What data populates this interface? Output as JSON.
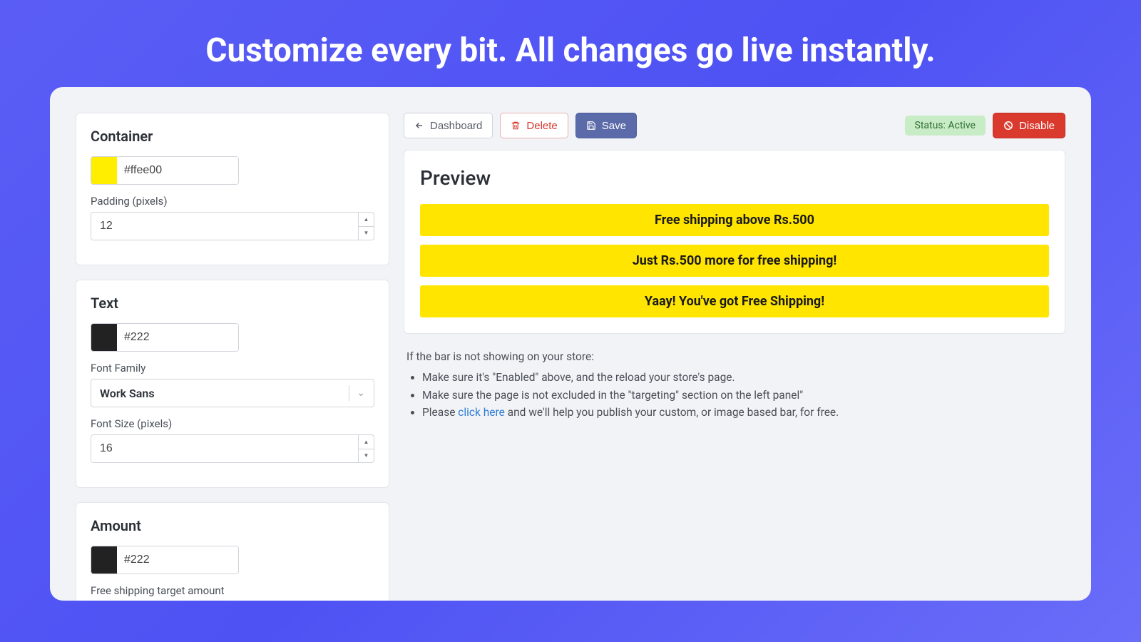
{
  "hero": {
    "title": "Customize every bit. All changes go live instantly."
  },
  "toolbar": {
    "dashboard": "Dashboard",
    "delete": "Delete",
    "save": "Save",
    "status": "Status: Active",
    "disable": "Disable"
  },
  "container": {
    "title": "Container",
    "color": "#ffee00",
    "swatch": "#ffee00",
    "padding_label": "Padding (pixels)",
    "padding": "12"
  },
  "text_section": {
    "title": "Text",
    "color": "#222",
    "swatch": "#222222",
    "font_family_label": "Font Family",
    "font_family": "Work Sans",
    "font_size_label": "Font Size (pixels)",
    "font_size": "16"
  },
  "amount": {
    "title": "Amount",
    "color": "#222",
    "swatch": "#222222",
    "target_label": "Free shipping target amount"
  },
  "preview": {
    "title": "Preview",
    "bars": [
      "Free shipping above Rs.500",
      "Just Rs.500 more for free shipping!",
      "Yaay! You've got Free Shipping!"
    ]
  },
  "help": {
    "intro": "If the bar is not showing on your store:",
    "item1": "Make sure it's \"Enabled\" above, and the reload your store's page.",
    "item2": "Make sure the page is not excluded in the \"targeting\" section on the left panel\"",
    "item3_pre": "Please ",
    "item3_link": "click here",
    "item3_post": " and we'll help you publish your custom, or image based bar, for free."
  }
}
